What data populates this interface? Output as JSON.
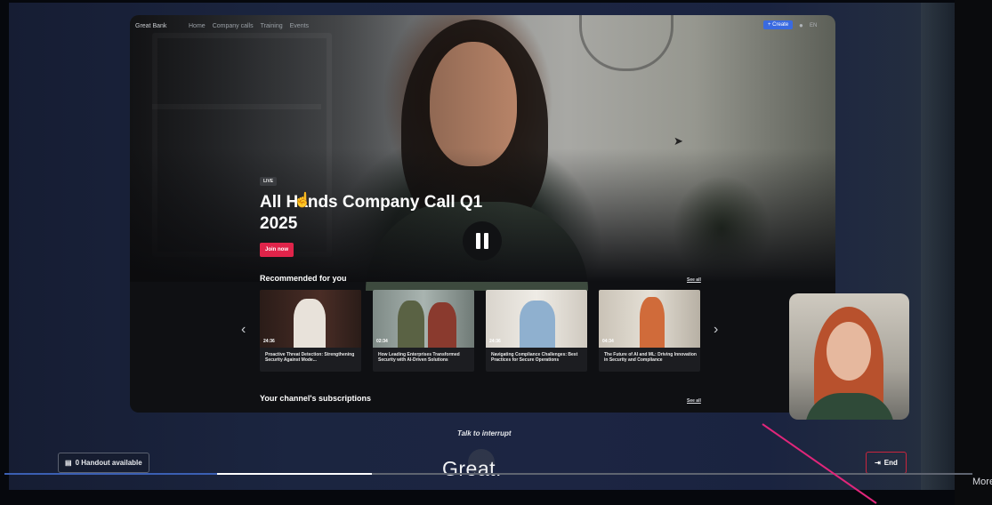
{
  "more_label": "More",
  "stage": {
    "nav": {
      "logo": "Great Bank",
      "links": [
        "Home",
        "Company calls",
        "Training",
        "Events"
      ],
      "create_label": "+ Create",
      "lang_label": "EN"
    },
    "hero": {
      "live_badge": "LIVE",
      "title": "All Hands Company Call Q1 2025",
      "join_label": "Join now"
    },
    "recommended": {
      "heading": "Recommended for you",
      "see_all": "See all",
      "cards": [
        {
          "duration": "24:36",
          "caption": "Proactive Threat Detection: Strengthening Security Against Mode..."
        },
        {
          "duration": "02:34",
          "caption": "How Leading Enterprises Transformed Security with AI-Driven Solutions"
        },
        {
          "duration": "24:36",
          "caption": "Navigating Compliance Challenges: Best Practices for Secure Operations"
        },
        {
          "duration": "04:34",
          "caption": "The Future of AI and ML: Driving Innovation in Security and Compliance"
        }
      ]
    },
    "subscriptions": {
      "heading": "Your channel's subscriptions",
      "see_all": "See all"
    }
  },
  "talk_label": "Talk to interrupt",
  "handout_label": "0 Handout available",
  "end_label": "End",
  "caption_text": "Great.",
  "progress": {
    "played_fraction": 0.22,
    "buffered_fraction": 0.38
  },
  "colors": {
    "join": "#e0244a",
    "end_border": "#c8253e",
    "accent_blue": "#3a6ae0",
    "pink_line": "#e0267a"
  }
}
